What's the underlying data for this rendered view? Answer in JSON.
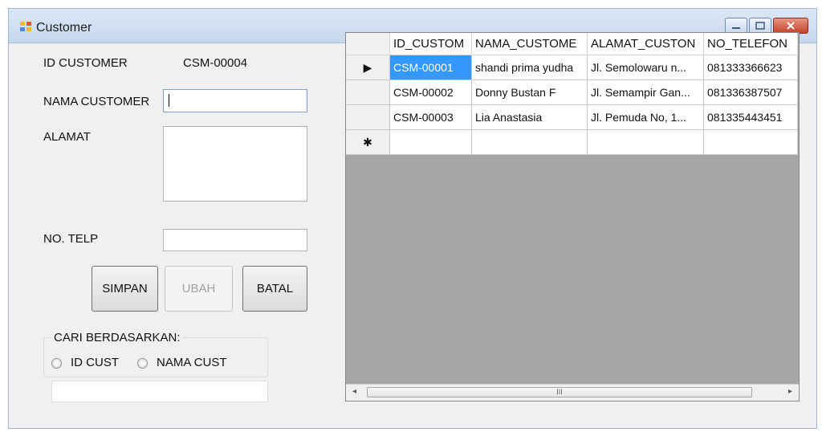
{
  "window": {
    "title": "Customer",
    "controls": {
      "minimize": "–",
      "maximize": "□",
      "close": "✕"
    }
  },
  "form": {
    "id_customer_label": "ID CUSTOMER",
    "id_customer_value": "CSM-00004",
    "nama_label": "NAMA CUSTOMER",
    "nama_value": "",
    "alamat_label": "ALAMAT",
    "alamat_value": "",
    "telp_label": "NO. TELP",
    "telp_value": ""
  },
  "buttons": {
    "simpan": "SIMPAN",
    "ubah": "UBAH",
    "batal": "BATAL"
  },
  "search": {
    "group_title": "CARI BERDASARKAN:",
    "option_id": "ID CUST",
    "option_nama": "NAMA CUST",
    "query": ""
  },
  "grid": {
    "columns": [
      "ID_CUSTOM",
      "NAMA_CUSTOME",
      "ALAMAT_CUSTON",
      "NO_TELEFON"
    ],
    "rows": [
      [
        "CSM-00001",
        "shandi prima yudha",
        "Jl. Semolowaru n...",
        "081333366623"
      ],
      [
        "CSM-00002",
        "Donny Bustan F",
        "Jl. Semampir Gan...",
        "081336387507"
      ],
      [
        "CSM-00003",
        "Lia Anastasia",
        "Jl. Pemuda No, 1...",
        "081335443451"
      ]
    ],
    "current_row_marker": "▶",
    "new_row_marker": "✱",
    "scroll_thumb_glyph": "III",
    "scroll_left": "◂",
    "scroll_right": "▸"
  },
  "colors": {
    "selection": "#3399ff",
    "grid_empty": "#a6a6a6",
    "window_bg": "#f0f0f0"
  }
}
